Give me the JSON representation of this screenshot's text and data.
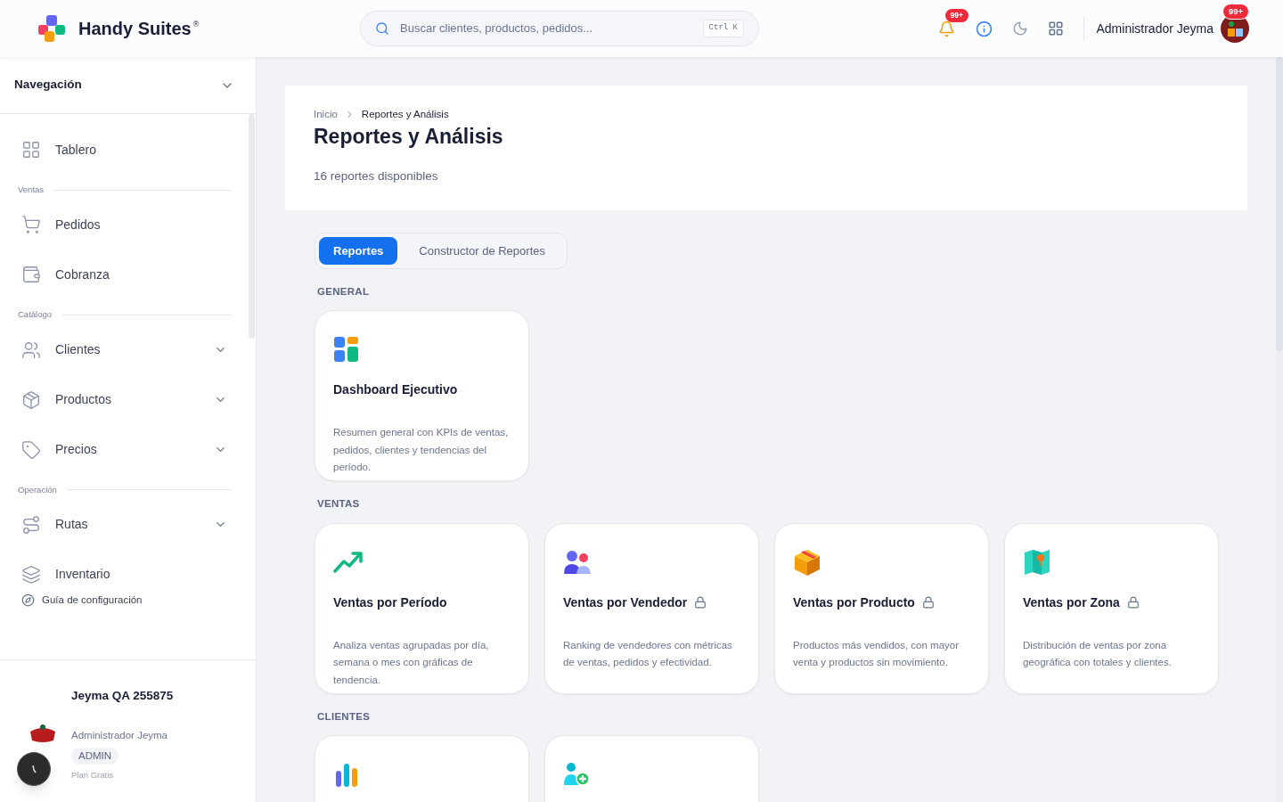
{
  "header": {
    "brand": "Handy Suites",
    "brand_mark": "®",
    "search": {
      "placeholder": "Buscar clientes, productos, pedidos...",
      "shortcut": "Ctrl K"
    },
    "notification_count": "99+",
    "user_name": "Administrador Jeyma",
    "avatar_badge": "99+"
  },
  "sidebar": {
    "title": "Navegación",
    "expanded": true,
    "groups": [
      {
        "items": [
          {
            "label": "Tablero",
            "kind": "grid",
            "expandable": false
          }
        ]
      },
      {
        "label": "Ventas",
        "items": [
          {
            "label": "Pedidos",
            "kind": "cart",
            "expandable": false
          },
          {
            "label": "Cobranza",
            "kind": "wallet",
            "expandable": false
          }
        ]
      },
      {
        "label": "Catálogo",
        "items": [
          {
            "label": "Clientes",
            "kind": "users",
            "expandable": true
          },
          {
            "label": "Productos",
            "kind": "box",
            "expandable": true
          },
          {
            "label": "Precios",
            "kind": "tag",
            "expandable": true
          }
        ]
      },
      {
        "label": "Operación",
        "items": [
          {
            "label": "Rutas",
            "kind": "route",
            "expandable": true
          },
          {
            "label": "Inventario",
            "kind": "layers",
            "expandable": false
          }
        ]
      }
    ],
    "guide_link": "Guía de configuración",
    "account": {
      "company": "Jeyma QA 255875",
      "user": "Administrador Jeyma",
      "role": "ADMIN",
      "plan": "Plan Gratis"
    }
  },
  "page": {
    "breadcrumb": [
      "Inicio",
      "Reportes y Análisis"
    ],
    "title": "Reportes y Análisis",
    "subtitle": "16 reportes disponibles",
    "tabs": [
      {
        "label": "Reportes",
        "selected": true
      },
      {
        "label": "Constructor de Reportes",
        "selected": false
      }
    ],
    "sections": [
      {
        "title": "GENERAL",
        "reports": [
          {
            "kind": "dashboard",
            "title": "Dashboard Ejecutivo",
            "locked": false,
            "description": "Resumen general con KPIs de ventas, pedidos, clientes y tendencias del período."
          }
        ]
      },
      {
        "title": "VENTAS",
        "reports": [
          {
            "kind": "trend",
            "title": "Ventas por Período",
            "locked": false,
            "description": "Analiza ventas agrupadas por día, semana o mes con gráficas de tendencia."
          },
          {
            "kind": "team",
            "title": "Ventas por Vendedor",
            "locked": true,
            "description": "Ranking de vendedores con métricas de ventas, pedidos y efectividad."
          },
          {
            "kind": "box",
            "title": "Ventas por Producto",
            "locked": true,
            "description": "Productos más vendidos, con mayor venta y productos sin movimiento."
          },
          {
            "kind": "map",
            "title": "Ventas por Zona",
            "locked": true,
            "description": "Distribución de ventas por zona geográfica con totales y clientes."
          }
        ]
      },
      {
        "title": "CLIENTES",
        "reports": [
          {
            "kind": "bars"
          },
          {
            "kind": "user-add"
          }
        ]
      }
    ]
  }
}
